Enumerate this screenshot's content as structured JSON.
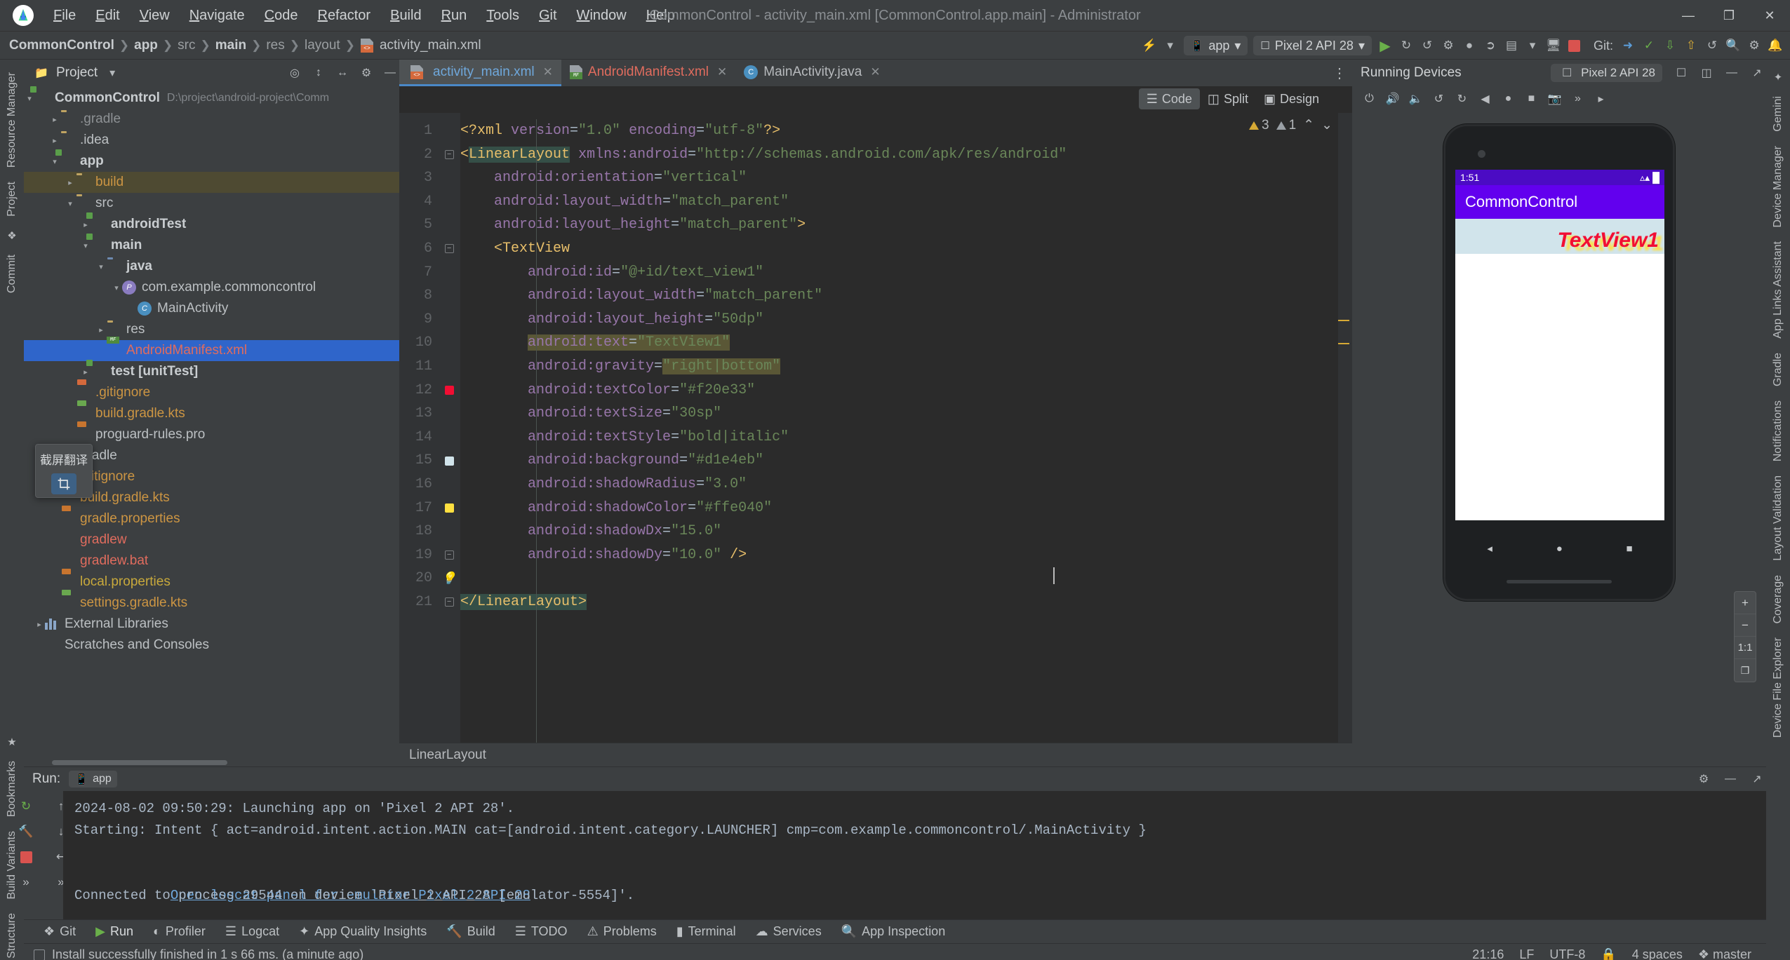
{
  "window": {
    "title": "CommonControl - activity_main.xml [CommonControl.app.main] - Administrator",
    "minimize": "—",
    "maximize": "❐",
    "close": "✕",
    "logo_icon": "android-studio-logo-icon"
  },
  "menubar": [
    "File",
    "Edit",
    "View",
    "Navigate",
    "Code",
    "Refactor",
    "Build",
    "Run",
    "Tools",
    "Git",
    "Window",
    "Help"
  ],
  "breadcrumb": {
    "segments": [
      {
        "label": "CommonControl",
        "style": "bold"
      },
      {
        "label": "app",
        "style": "bold"
      },
      {
        "label": "src",
        "style": "dim"
      },
      {
        "label": "main",
        "style": "bold"
      },
      {
        "label": "res",
        "style": "dim"
      },
      {
        "label": "layout",
        "style": "dim"
      }
    ],
    "file": "activity_main.xml",
    "file_icon": "xml-file-icon",
    "separator": "❯"
  },
  "main_toolbar": {
    "icons": [
      "lightning-icon",
      "chevron-down-icon"
    ],
    "run_config": {
      "label": "app",
      "icon": "android-app-icon",
      "chevron": "▾"
    },
    "device": {
      "label": "Pixel 2 API 28",
      "icon": "device-phone-icon",
      "chevron": "▾"
    },
    "run_button_icon": "run-play-icon",
    "buttons": [
      "run-icon",
      "apply-changes-icon",
      "apply-code-changes-icon",
      "restart-icon",
      "attach-debugger-icon",
      "debug-icon",
      "profiler-icon",
      "more-icon",
      "coverage-icon",
      "stop-icon"
    ],
    "git_label": "Git:",
    "git_icons": [
      "git-branch-icon",
      "check-icon",
      "update-icon",
      "commit-icon",
      "history-icon",
      "search-icon",
      "settings-icon",
      "notifications-icon"
    ]
  },
  "project_panel": {
    "title": "Project",
    "header_icons": [
      "chevron-down-icon",
      "locate-icon",
      "expand-all-icon",
      "collapse-all-icon",
      "gear-icon",
      "hide-icon"
    ],
    "root": {
      "label": "CommonControl",
      "path": "D:\\project\\android-project\\Comm"
    },
    "tree": [
      {
        "indent": 1,
        "arrow": "▸",
        "icon": "folder-icon",
        "label": ".gradle",
        "style": "dim"
      },
      {
        "indent": 1,
        "arrow": "▸",
        "icon": "folder-icon",
        "label": ".idea",
        "style": "normal"
      },
      {
        "indent": 1,
        "arrow": "▾",
        "icon": "module-icon",
        "label": "app",
        "style": "bold"
      },
      {
        "indent": 2,
        "arrow": "▸",
        "icon": "folder-icon",
        "label": "build",
        "style": "orange",
        "highlight": true
      },
      {
        "indent": 2,
        "arrow": "▾",
        "icon": "folder-icon",
        "label": "src",
        "style": "normal"
      },
      {
        "indent": 3,
        "arrow": "▸",
        "icon": "module-icon",
        "label": "androidTest",
        "style": "bold"
      },
      {
        "indent": 3,
        "arrow": "▾",
        "icon": "module-icon",
        "label": "main",
        "style": "bold"
      },
      {
        "indent": 4,
        "arrow": "▾",
        "icon": "folder-blue-icon",
        "label": "java",
        "style": "bold"
      },
      {
        "indent": 5,
        "arrow": "▾",
        "icon": "package-icon",
        "label": "com.example.commoncontrol",
        "style": "normal"
      },
      {
        "indent": 6,
        "arrow": "",
        "icon": "java-class-icon",
        "label": "MainActivity",
        "style": "normal"
      },
      {
        "indent": 4,
        "arrow": "▸",
        "icon": "folder-icon",
        "label": "res",
        "style": "normal"
      },
      {
        "indent": 4,
        "arrow": "",
        "icon": "manifest-file-icon",
        "label": "AndroidManifest.xml",
        "style": "selected"
      },
      {
        "indent": 3,
        "arrow": "▸",
        "icon": "module-icon",
        "label": "test [unitTest]",
        "style": "bold"
      },
      {
        "indent": 2,
        "arrow": "",
        "icon": "gitignore-icon",
        "label": ".gitignore",
        "style": "orange"
      },
      {
        "indent": 2,
        "arrow": "",
        "icon": "gradle-file-icon",
        "label": "build.gradle.kts",
        "style": "orange"
      },
      {
        "indent": 2,
        "arrow": "",
        "icon": "properties-file-icon",
        "label": "proguard-rules.pro",
        "style": "normal"
      },
      {
        "indent": 1,
        "arrow": "▸",
        "icon": "folder-icon",
        "label": "gradle",
        "style": "normal"
      },
      {
        "indent": 1,
        "arrow": "",
        "icon": "gitignore-icon",
        "label": ".gitignore",
        "style": "orange"
      },
      {
        "indent": 1,
        "arrow": "",
        "icon": "gradle-file-icon",
        "label": "build.gradle.kts",
        "style": "orange"
      },
      {
        "indent": 1,
        "arrow": "",
        "icon": "properties-file-icon",
        "label": "gradle.properties",
        "style": "orange"
      },
      {
        "indent": 1,
        "arrow": "",
        "icon": "file-icon",
        "label": "gradlew",
        "style": "red"
      },
      {
        "indent": 1,
        "arrow": "",
        "icon": "file-icon",
        "label": "gradlew.bat",
        "style": "red"
      },
      {
        "indent": 1,
        "arrow": "",
        "icon": "properties-file-icon",
        "label": "local.properties",
        "style": "yellow"
      },
      {
        "indent": 1,
        "arrow": "",
        "icon": "gradle-file-icon",
        "label": "settings.gradle.kts",
        "style": "orange"
      },
      {
        "indent": 0,
        "arrow": "▸",
        "icon": "library-icon",
        "label": "External Libraries",
        "style": "normal"
      },
      {
        "indent": 0,
        "arrow": "",
        "icon": "scratches-icon",
        "label": "Scratches and Consoles",
        "style": "normal"
      }
    ]
  },
  "translate_popup": {
    "title": "截屏翻译",
    "icon": "screenshot-crop-icon"
  },
  "left_rail": [
    {
      "label": "Resource Manager",
      "icon": "resource-manager-icon"
    },
    {
      "label": "Project",
      "icon": "project-icon"
    },
    {
      "label": "Commit",
      "icon": "commit-icon"
    },
    {
      "label": "Bookmarks",
      "icon": "bookmarks-icon"
    },
    {
      "label": "Build Variants",
      "icon": "build-variants-icon"
    },
    {
      "label": "Structure",
      "icon": "structure-icon"
    }
  ],
  "right_rail": [
    {
      "label": "Gemini",
      "icon": "gemini-icon"
    },
    {
      "label": "Device Manager",
      "icon": "device-manager-icon"
    },
    {
      "label": "App Links Assistant",
      "icon": "app-links-icon"
    },
    {
      "label": "Gradle",
      "icon": "gradle-icon"
    },
    {
      "label": "Notifications",
      "icon": "notifications-icon"
    },
    {
      "label": "Layout Validation",
      "icon": "layout-validation-icon"
    },
    {
      "label": "Coverage",
      "icon": "coverage-icon"
    },
    {
      "label": "Device File Explorer",
      "icon": "device-file-explorer-icon"
    }
  ],
  "editor": {
    "tabs": [
      {
        "label": "activity_main.xml",
        "icon": "xml-file-icon",
        "active": true,
        "closable": true,
        "color": "blue"
      },
      {
        "label": "AndroidManifest.xml",
        "icon": "manifest-file-icon",
        "active": false,
        "closable": true,
        "color": "red"
      },
      {
        "label": "MainActivity.java",
        "icon": "java-class-icon",
        "active": false,
        "closable": true,
        "color": "normal"
      }
    ],
    "tab_overflow_icon": "more-vertical-icon",
    "view_modes": [
      {
        "label": "Code",
        "icon": "code-view-icon",
        "active": true
      },
      {
        "label": "Split",
        "icon": "split-view-icon",
        "active": false
      },
      {
        "label": "Design",
        "icon": "design-view-icon",
        "active": false
      }
    ],
    "design_toolbar_icons": [
      "refresh-icon",
      "volume-up-icon",
      "volume-down-icon",
      "rotate-left-icon",
      "rotate-right-icon",
      "back-icon",
      "home-icon",
      "square-icon",
      "screenshot-icon",
      "more-icon",
      "chevron-right-icon"
    ],
    "inspections": {
      "warnings": "3",
      "weak_warnings": "1",
      "warning_icon": "warning-triangle-icon",
      "weak_icon": "weak-warning-icon",
      "up_icon": "⌃",
      "down_icon": "⌄"
    },
    "status_left": "LinearLayout",
    "lines": [
      {
        "n": "1",
        "marker": "",
        "tokens": [
          {
            "t": "<?xml ",
            "c": "t-pi"
          },
          {
            "t": "version",
            "c": "t-attr"
          },
          {
            "t": "=",
            "c": "t-txt"
          },
          {
            "t": "\"1.0\"",
            "c": "t-str"
          },
          {
            "t": " encoding",
            "c": "t-attr"
          },
          {
            "t": "=",
            "c": "t-txt"
          },
          {
            "t": "\"utf-8\"",
            "c": "t-str"
          },
          {
            "t": "?>",
            "c": "t-pi"
          }
        ]
      },
      {
        "n": "2",
        "marker": "fold",
        "tokens": [
          {
            "t": "<",
            "c": "t-tag"
          },
          {
            "t": "LinearLayout",
            "c": "t-tag hl-occ"
          },
          {
            "t": " ",
            "c": "t-txt"
          },
          {
            "t": "xmlns:android",
            "c": "t-ns"
          },
          {
            "t": "=",
            "c": "t-txt"
          },
          {
            "t": "\"http://schemas.android.com/apk/res/android\"",
            "c": "t-str"
          }
        ]
      },
      {
        "n": "3",
        "marker": "",
        "tokens": [
          {
            "t": "    android:orientation",
            "c": "t-attr"
          },
          {
            "t": "=",
            "c": "t-txt"
          },
          {
            "t": "\"vertical\"",
            "c": "t-str"
          }
        ]
      },
      {
        "n": "4",
        "marker": "",
        "tokens": [
          {
            "t": "    android:layout_width",
            "c": "t-attr"
          },
          {
            "t": "=",
            "c": "t-txt"
          },
          {
            "t": "\"match_parent\"",
            "c": "t-str"
          }
        ]
      },
      {
        "n": "5",
        "marker": "",
        "tokens": [
          {
            "t": "    android:layout_height",
            "c": "t-attr"
          },
          {
            "t": "=",
            "c": "t-txt"
          },
          {
            "t": "\"match_parent\"",
            "c": "t-str"
          },
          {
            "t": ">",
            "c": "t-tag"
          }
        ]
      },
      {
        "n": "6",
        "marker": "fold",
        "tokens": [
          {
            "t": "    <TextView",
            "c": "t-tag"
          }
        ]
      },
      {
        "n": "7",
        "marker": "",
        "tokens": [
          {
            "t": "        android:id",
            "c": "t-attr"
          },
          {
            "t": "=",
            "c": "t-txt"
          },
          {
            "t": "\"@+id/text_view1\"",
            "c": "t-str"
          }
        ]
      },
      {
        "n": "8",
        "marker": "",
        "tokens": [
          {
            "t": "        android:layout_width",
            "c": "t-attr"
          },
          {
            "t": "=",
            "c": "t-txt"
          },
          {
            "t": "\"match_parent\"",
            "c": "t-str"
          }
        ]
      },
      {
        "n": "9",
        "marker": "",
        "tokens": [
          {
            "t": "        android:layout_height",
            "c": "t-attr"
          },
          {
            "t": "=",
            "c": "t-txt"
          },
          {
            "t": "\"50dp\"",
            "c": "t-str"
          }
        ]
      },
      {
        "n": "10",
        "marker": "",
        "tokens": [
          {
            "t": "        ",
            "c": "t-txt"
          },
          {
            "t": "android:text",
            "c": "t-attr hl-sel"
          },
          {
            "t": "=",
            "c": "t-txt hl-sel"
          },
          {
            "t": "\"TextView1\"",
            "c": "t-str hl-sel"
          }
        ]
      },
      {
        "n": "11",
        "marker": "",
        "tokens": [
          {
            "t": "        android:gravity",
            "c": "t-attr"
          },
          {
            "t": "=",
            "c": "t-txt"
          },
          {
            "t": "\"right|bottom\"",
            "c": "t-str hl-sel"
          }
        ]
      },
      {
        "n": "12",
        "marker": "sq-red",
        "tokens": [
          {
            "t": "        android:textColor",
            "c": "t-attr"
          },
          {
            "t": "=",
            "c": "t-txt"
          },
          {
            "t": "\"#f20e33\"",
            "c": "t-str"
          }
        ]
      },
      {
        "n": "13",
        "marker": "",
        "tokens": [
          {
            "t": "        android:textSize",
            "c": "t-attr"
          },
          {
            "t": "=",
            "c": "t-txt"
          },
          {
            "t": "\"30sp\"",
            "c": "t-str"
          }
        ]
      },
      {
        "n": "14",
        "marker": "",
        "tokens": [
          {
            "t": "        android:textStyle",
            "c": "t-attr"
          },
          {
            "t": "=",
            "c": "t-txt"
          },
          {
            "t": "\"bold|italic\"",
            "c": "t-str"
          }
        ]
      },
      {
        "n": "15",
        "marker": "sq-blue",
        "tokens": [
          {
            "t": "        android:background",
            "c": "t-attr"
          },
          {
            "t": "=",
            "c": "t-txt"
          },
          {
            "t": "\"#d1e4eb\"",
            "c": "t-str"
          }
        ]
      },
      {
        "n": "16",
        "marker": "",
        "tokens": [
          {
            "t": "        android:shadowRadius",
            "c": "t-attr"
          },
          {
            "t": "=",
            "c": "t-txt"
          },
          {
            "t": "\"3.0\"",
            "c": "t-str"
          }
        ]
      },
      {
        "n": "17",
        "marker": "sq-yellow",
        "tokens": [
          {
            "t": "        android:shadowColor",
            "c": "t-attr"
          },
          {
            "t": "=",
            "c": "t-txt"
          },
          {
            "t": "\"#ffe040\"",
            "c": "t-str"
          }
        ]
      },
      {
        "n": "18",
        "marker": "",
        "tokens": [
          {
            "t": "        android:shadowDx",
            "c": "t-attr"
          },
          {
            "t": "=",
            "c": "t-txt"
          },
          {
            "t": "\"15.0\"",
            "c": "t-str"
          }
        ]
      },
      {
        "n": "19",
        "marker": "fold",
        "tokens": [
          {
            "t": "        android:shadowDy",
            "c": "t-attr"
          },
          {
            "t": "=",
            "c": "t-txt"
          },
          {
            "t": "\"10.0\"",
            "c": "t-str"
          },
          {
            "t": " />",
            "c": "t-tag"
          }
        ]
      },
      {
        "n": "20",
        "marker": "bulb",
        "tokens": [
          {
            "t": "",
            "c": "t-txt"
          }
        ]
      },
      {
        "n": "21",
        "marker": "fold",
        "tokens": [
          {
            "t": "</LinearLayout>",
            "c": "t-tag hl-occ"
          }
        ]
      }
    ]
  },
  "emulator": {
    "title": "Running Devices",
    "device_tab": {
      "label": "Pixel 2 API 28",
      "icon": "device-phone-icon"
    },
    "header_icons": [
      "new-tab-icon",
      "split-icon",
      "minimize-icon",
      "hide-icon"
    ],
    "toolbar_icons": [
      "power-icon",
      "volume-up-icon",
      "volume-down-icon",
      "rotate-left-icon",
      "rotate-right-icon",
      "back-icon",
      "home-icon",
      "overview-icon",
      "screenshot-icon",
      "more-icon",
      "chevron-right-icon"
    ],
    "screen": {
      "status_time": "1:51",
      "status_icons": "battery-wifi-signal-icons",
      "app_title": "CommonControl",
      "textview_text": "TextView1",
      "textview_color": "#f20e33",
      "textview_bg": "#d1e4eb",
      "shadow_color": "#ffe040",
      "appbar_color": "#6200ee"
    },
    "nav_icons": [
      "back-triangle-icon",
      "home-circle-icon",
      "recents-square-icon"
    ],
    "zoom_controls": [
      {
        "label": "+",
        "name": "zoom-in-button"
      },
      {
        "label": "−",
        "name": "zoom-out-button"
      },
      {
        "label": "1:1",
        "name": "zoom-actual-button"
      },
      {
        "label": "❐",
        "name": "zoom-fit-button"
      }
    ]
  },
  "run_panel": {
    "title": "Run:",
    "config_chip": {
      "label": "app",
      "icon": "android-app-icon"
    },
    "header_icons": [
      "gear-icon",
      "minimize-icon",
      "hide-icon"
    ],
    "rail_icons": [
      "rerun-icon",
      "scroll-up-icon",
      "build-icon",
      "scroll-down-icon",
      "stop-icon",
      "soft-wrap-icon"
    ],
    "rail2_icons": [
      "more-icon",
      "more-icon"
    ],
    "console": [
      {
        "text": "2024-08-02 09:50:29: Launching app on 'Pixel 2 API 28'.",
        "link": false
      },
      {
        "text": "Starting: Intent { act=android.intent.action.MAIN cat=[android.intent.category.LAUNCHER] cmp=com.example.commoncontrol/.MainActivity }",
        "link": false
      },
      {
        "text": "",
        "link": false
      },
      {
        "text": "Open logcat panel for emulator Pixel 2 API 28",
        "link": true
      },
      {
        "text": "Connected to process 29544 on device 'Pixel_2_API_28 [emulator-5554]'.",
        "link": false
      }
    ]
  },
  "tool_tabs": [
    {
      "label": "Git",
      "icon": "git-icon",
      "active": false
    },
    {
      "label": "Run",
      "icon": "run-play-icon",
      "active": true
    },
    {
      "label": "Profiler",
      "icon": "profiler-icon",
      "active": false
    },
    {
      "label": "Logcat",
      "icon": "logcat-icon",
      "active": false
    },
    {
      "label": "App Quality Insights",
      "icon": "app-quality-icon",
      "active": false
    },
    {
      "label": "Build",
      "icon": "build-hammer-icon",
      "active": false
    },
    {
      "label": "TODO",
      "icon": "todo-icon",
      "active": false
    },
    {
      "label": "Problems",
      "icon": "problems-icon",
      "active": false
    },
    {
      "label": "Terminal",
      "icon": "terminal-icon",
      "active": false
    },
    {
      "label": "Services",
      "icon": "services-icon",
      "active": false
    },
    {
      "label": "App Inspection",
      "icon": "app-inspection-icon",
      "active": false
    }
  ],
  "status_bar": {
    "message": "Install successfully finished in 1 s 66 ms. (a minute ago)",
    "caret": "21:16",
    "line_sep": "LF",
    "encoding": "UTF-8",
    "lock_icon": "read-only-lock-icon",
    "indent": "4 spaces",
    "branch": "master",
    "branch_icon": "git-branch-icon"
  }
}
